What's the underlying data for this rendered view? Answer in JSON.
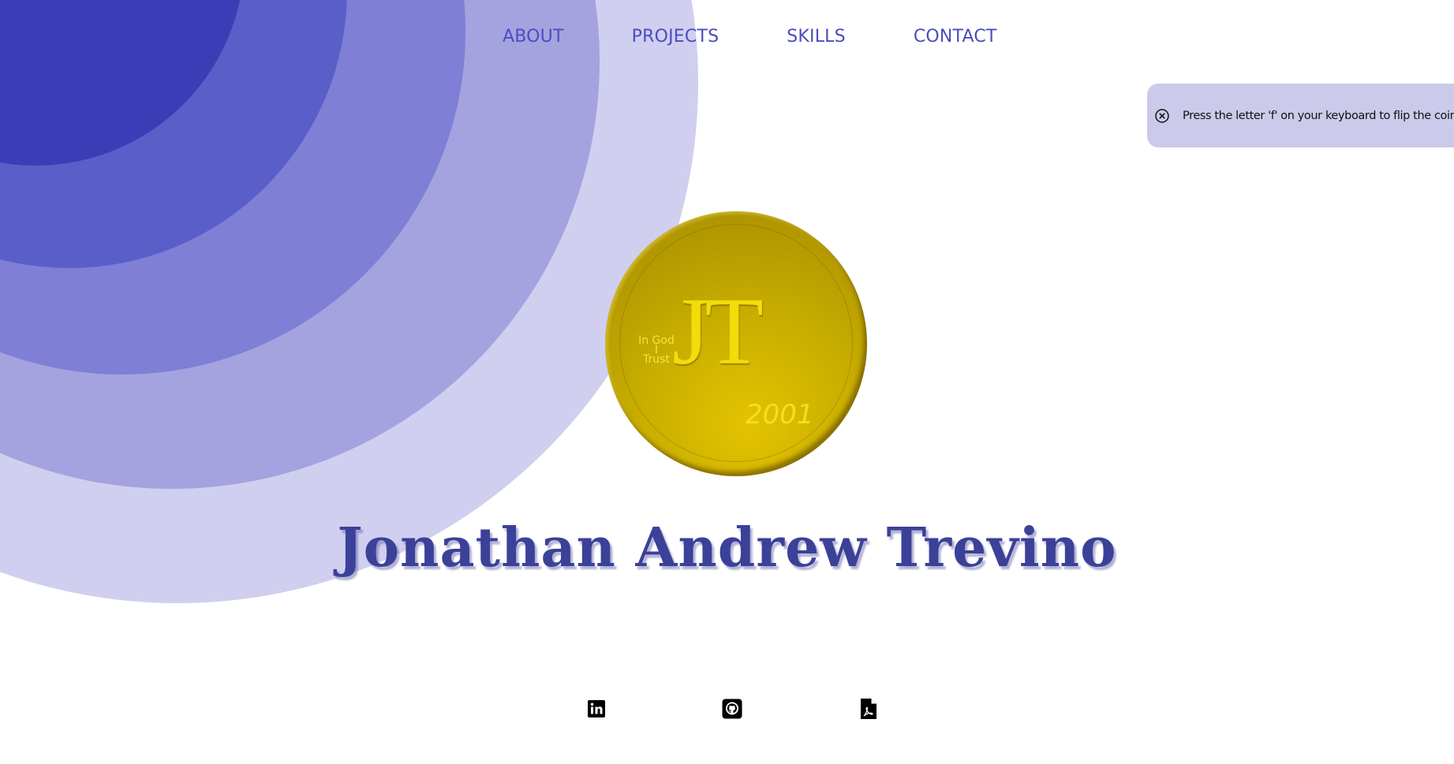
{
  "nav": {
    "items": [
      {
        "label": "ABOUT"
      },
      {
        "label": "PROJECTS"
      },
      {
        "label": "SKILLS"
      },
      {
        "label": "CONTACT"
      }
    ]
  },
  "toast": {
    "message": "Press the letter 'f' on your keyboard to flip the coin!",
    "close_icon": "close-circle-icon"
  },
  "coin": {
    "monogram": "JT",
    "motto_line1": "In God",
    "motto_line2": "I",
    "motto_line3": "Trust",
    "year": "2001",
    "color": "#d4b800"
  },
  "hero": {
    "name": "Jonathan Andrew Trevino"
  },
  "social": [
    {
      "icon": "linkedin-icon"
    },
    {
      "icon": "github-icon"
    },
    {
      "icon": "pdf-file-icon"
    }
  ],
  "colors": {
    "accent": "#4b4cc0",
    "name_text": "#3b4198",
    "toast_bg": "#cbcaea",
    "ripple": [
      "#3a3db5",
      "#5a5ec8",
      "#7e7fd5",
      "#a4a3e0",
      "#d0cfef"
    ]
  }
}
